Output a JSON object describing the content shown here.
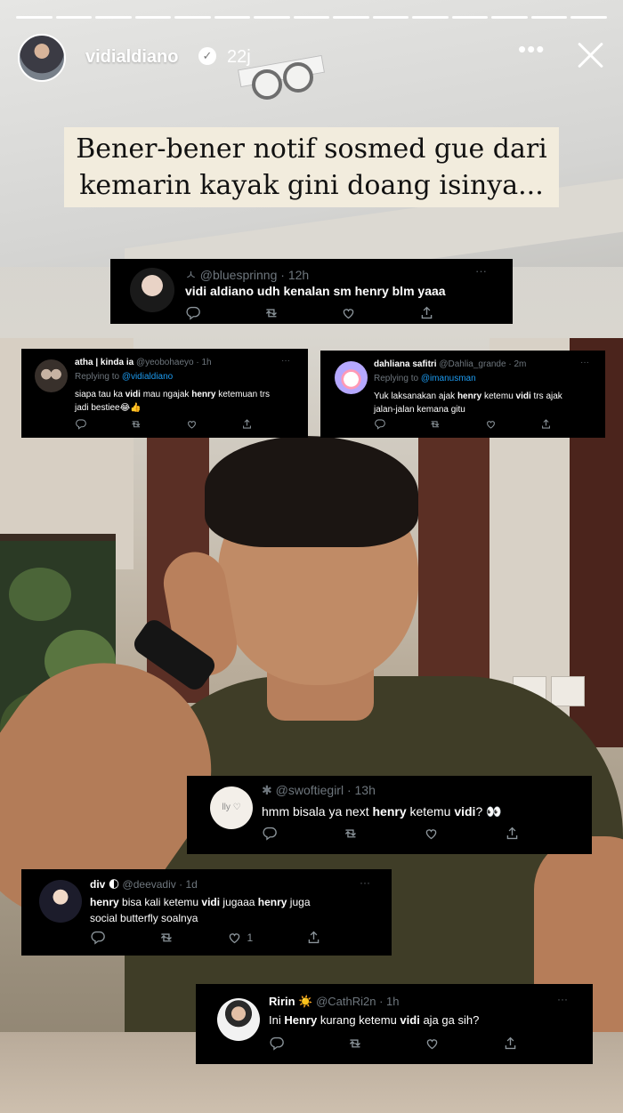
{
  "story": {
    "segments": 15,
    "username": "vidialdiano",
    "time": "22j",
    "more_label": "•••"
  },
  "caption": {
    "line1": "Bener-bener notif sosmed gue dari",
    "line2": "kemarin kayak gini doang isinya..."
  },
  "tweets": [
    {
      "prefix": "ㅅ",
      "handle": "@bluesprinng",
      "time": "· 12h",
      "parts": [
        {
          "t": "vidi",
          "b": true
        },
        {
          "t": " aldiano udh kenalan sm ",
          "b": true
        },
        {
          "t": "henry",
          "b": true
        },
        {
          "t": " blm yaaa",
          "b": true
        }
      ]
    },
    {
      "name": "atha | kinda ia",
      "handle": "@yeobohaeyo",
      "time": "· 1h",
      "replying_prefix": "Replying to",
      "replying_to": "@vidialdiano",
      "line1": [
        {
          "t": "siapa tau ka "
        },
        {
          "t": "vidi",
          "b": true
        },
        {
          "t": " mau ngajak "
        },
        {
          "t": "henry",
          "b": true
        },
        {
          "t": " ketemuan trs"
        }
      ],
      "line2": [
        {
          "t": "jadi bestiee😂👍"
        }
      ]
    },
    {
      "name": "dahliana safitri",
      "handle": "@Dahlia_grande",
      "time": "· 2m",
      "replying_prefix": "Replying to",
      "replying_to": "@imanusman",
      "line1": [
        {
          "t": "Yuk laksanakan ajak "
        },
        {
          "t": "henry",
          "b": true
        },
        {
          "t": " ketemu "
        },
        {
          "t": "vidi",
          "b": true
        },
        {
          "t": " trs ajak"
        }
      ],
      "line2": [
        {
          "t": "jalan-jalan kemana gitu"
        }
      ]
    },
    {
      "prefix": "✱",
      "handle": "@swoftiegirl",
      "time": "· 13h",
      "avatar_text": "lly ♡",
      "parts": [
        {
          "t": "hmm bisala ya next "
        },
        {
          "t": "henry",
          "b": true
        },
        {
          "t": " ketemu "
        },
        {
          "t": "vidi",
          "b": true
        },
        {
          "t": "? 👀"
        }
      ]
    },
    {
      "name": "div",
      "name_icon": "🌓",
      "handle": "@deevadiv",
      "time": "· 1d",
      "line1": [
        {
          "t": "henry",
          "b": true
        },
        {
          "t": " bisa kali ketemu "
        },
        {
          "t": "vidi",
          "b": true
        },
        {
          "t": " jugaaa "
        },
        {
          "t": "henry",
          "b": true
        },
        {
          "t": " juga"
        }
      ],
      "line2": [
        {
          "t": "social butterfly soalnya"
        }
      ],
      "like_count": "1"
    },
    {
      "name": "Ririn",
      "name_icon": "☀️",
      "handle": "@CathRi2n",
      "time": "· 1h",
      "parts": [
        {
          "t": "Ini "
        },
        {
          "t": "Henry",
          "b": true
        },
        {
          "t": " kurang ketemu "
        },
        {
          "t": "vidi",
          "b": true
        },
        {
          "t": " aja ga sih?"
        }
      ]
    }
  ],
  "tweet_more_label": "···",
  "icons": [
    "reply-icon",
    "retweet-icon",
    "like-icon",
    "share-icon",
    "verified-icon",
    "close-icon"
  ]
}
